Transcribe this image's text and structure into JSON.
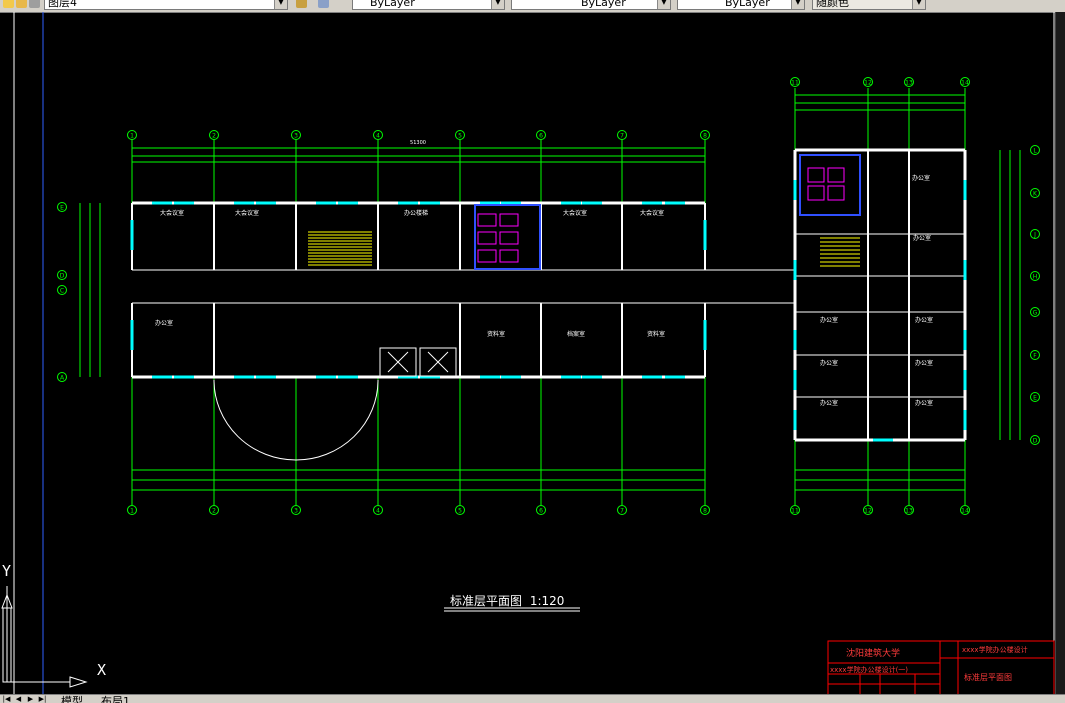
{
  "toolbar": {
    "layer_value": "图层4",
    "color_value": "ByLayer",
    "linetype_value": "ByLayer",
    "lineweight_value": "ByLayer",
    "plotstyle_value": "随颜色"
  },
  "drawing": {
    "title": "标准层平面图",
    "scale": "1:120",
    "top_overall_dim": "51300",
    "grid_columns_main": [
      "1",
      "2",
      "3",
      "4",
      "5",
      "6",
      "7",
      "8"
    ],
    "grid_columns_wing": [
      "11",
      "12",
      "13",
      "14"
    ],
    "grid_rows_left": [
      "E",
      "D",
      "C",
      "A"
    ],
    "grid_rows_right": [
      "L",
      "K",
      "J",
      "H",
      "G",
      "F",
      "E",
      "D"
    ],
    "room_labels": [
      "大会议室",
      "大会议室",
      "办公楼梯",
      "大会议室",
      "大会议室",
      "办公室",
      "资料室",
      "档案室",
      "资料室",
      "办公室",
      "办公室",
      "办公室",
      "办公室",
      "办公室",
      "办公室",
      "办公室",
      "办公室"
    ]
  },
  "title_block": {
    "school": "沈阳建筑大学",
    "project_code": "xxxx学院办公楼设计",
    "sheet_title": "标准层平面图",
    "row_label": "xxxx学院办公楼设计(一)"
  },
  "ucs": {
    "x_label": "X",
    "y_label": "Y"
  },
  "tabs": {
    "model": "模型",
    "layout1": "布局1"
  },
  "colors": {
    "background": "#000000",
    "walls": "#ffffff",
    "dimension": "#00ff00",
    "window": "#00ffff",
    "title_block": "#ff0000",
    "stair": "#ffff00"
  }
}
